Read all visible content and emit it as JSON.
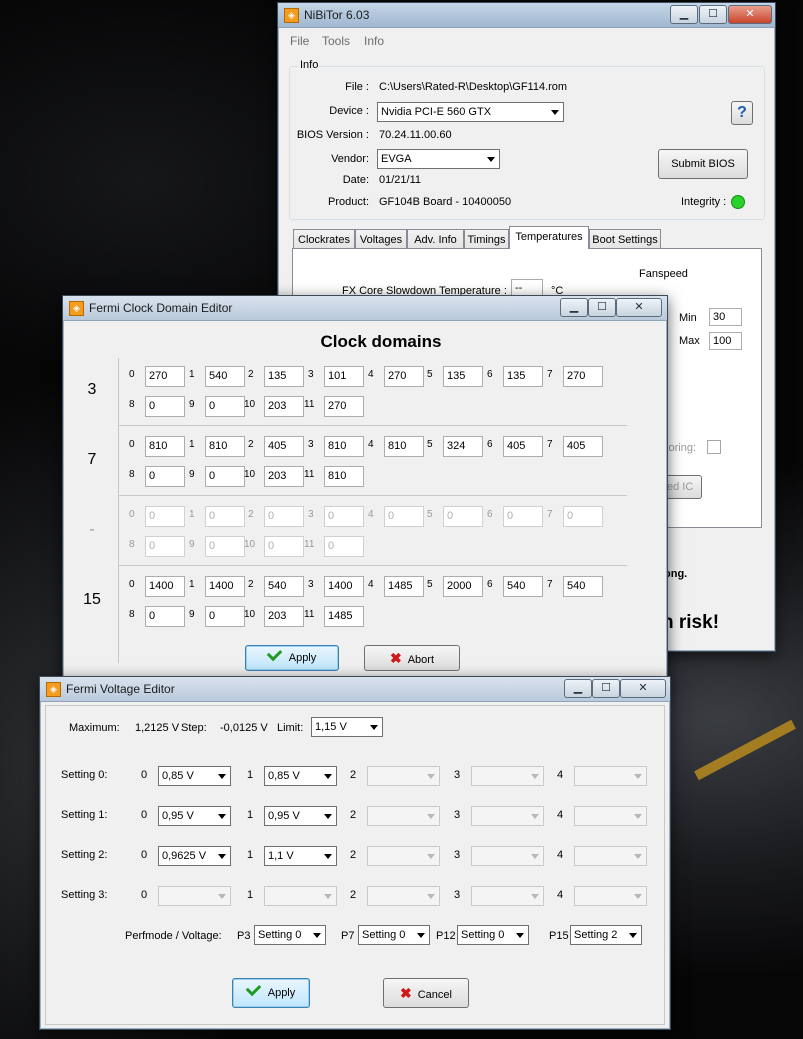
{
  "nibitor": {
    "title": "NiBiTor 6.03",
    "menu": [
      "File",
      "Tools",
      "Info"
    ],
    "info_group": "Info",
    "file_label": "File :",
    "file_value": "C:\\Users\\Rated-R\\Desktop\\GF114.rom",
    "device_label": "Device :",
    "device_value": "Nvidia PCI-E 560 GTX",
    "bios_label": "BIOS Version :",
    "bios_value": "70.24.11.00.60",
    "vendor_label": "Vendor:",
    "vendor_value": "EVGA",
    "date_label": "Date:",
    "date_value": "01/21/11",
    "product_label": "Product:",
    "product_value": "GF104B Board - 10400050",
    "help_label": "?",
    "submit_label": "Submit BIOS",
    "integrity_label": "Integrity :",
    "tabs": [
      "Clockrates",
      "Voltages",
      "Adv. Info",
      "Timings",
      "Temperatures",
      "Boot Settings"
    ],
    "fanspeed_label": "Fanspeed",
    "fx_label": "FX Core Slowdown Temperature :",
    "fx_value": "--",
    "fx_unit": "°C",
    "min_label": "Min",
    "min_value": "30",
    "max_label": "Max",
    "max_value": "100",
    "monitoring_label": "itoring:",
    "ic_label": "ed IC",
    "note_partial": "ong.",
    "risk_partial": "n risk!"
  },
  "clock": {
    "title": "Fermi Clock Domain Editor",
    "heading": "Clock domains",
    "rows": [
      {
        "label": "3",
        "disabled": false,
        "values": [
          "270",
          "540",
          "135",
          "101",
          "270",
          "135",
          "135",
          "270",
          "0",
          "0",
          "203",
          "270"
        ]
      },
      {
        "label": "7",
        "disabled": false,
        "values": [
          "810",
          "810",
          "405",
          "810",
          "810",
          "324",
          "405",
          "405",
          "0",
          "0",
          "203",
          "810"
        ]
      },
      {
        "label": "-",
        "disabled": true,
        "values": [
          "0",
          "0",
          "0",
          "0",
          "0",
          "0",
          "0",
          "0",
          "0",
          "0",
          "0",
          "0"
        ]
      },
      {
        "label": "15",
        "disabled": false,
        "values": [
          "1400",
          "1400",
          "540",
          "1400",
          "1485",
          "2000",
          "540",
          "540",
          "0",
          "0",
          "203",
          "1485"
        ]
      }
    ],
    "indices": [
      "0",
      "1",
      "2",
      "3",
      "4",
      "5",
      "6",
      "7",
      "8",
      "9",
      "10",
      "11"
    ],
    "apply_label": "Apply",
    "abort_label": "Abort"
  },
  "voltage": {
    "title": "Fermi Voltage Editor",
    "maximum_label": "Maximum:",
    "maximum_value": "1,2125 V",
    "step_label": "Step:",
    "step_value": "-0,0125 V",
    "limit_label": "Limit:",
    "limit_value": "1,15 V",
    "indices": [
      "0",
      "1",
      "2",
      "3",
      "4"
    ],
    "settings": [
      {
        "label": "Setting 0:",
        "values": [
          "0,85 V",
          "0,85 V",
          "",
          "",
          ""
        ]
      },
      {
        "label": "Setting 1:",
        "values": [
          "0,95 V",
          "0,95 V",
          "",
          "",
          ""
        ]
      },
      {
        "label": "Setting 2:",
        "values": [
          "0,9625 V",
          "1,1 V",
          "",
          "",
          ""
        ]
      },
      {
        "label": "Setting 3:",
        "values": [
          "",
          "",
          "",
          "",
          ""
        ]
      }
    ],
    "perfmode_label": "Perfmode / Voltage:",
    "perfmodes": [
      {
        "label": "P3",
        "value": "Setting 0"
      },
      {
        "label": "P7",
        "value": "Setting 0"
      },
      {
        "label": "P12",
        "value": "Setting 0"
      },
      {
        "label": "P15",
        "value": "Setting 2"
      }
    ],
    "apply_label": "Apply",
    "cancel_label": "Cancel"
  },
  "window_buttons": {
    "minimize": "▁",
    "maximize": "☐",
    "close": "✕"
  },
  "colors": {
    "integrity_ok": "#29d229",
    "titlebar": "#b9c9da",
    "app_icon": "#f39c1e"
  }
}
